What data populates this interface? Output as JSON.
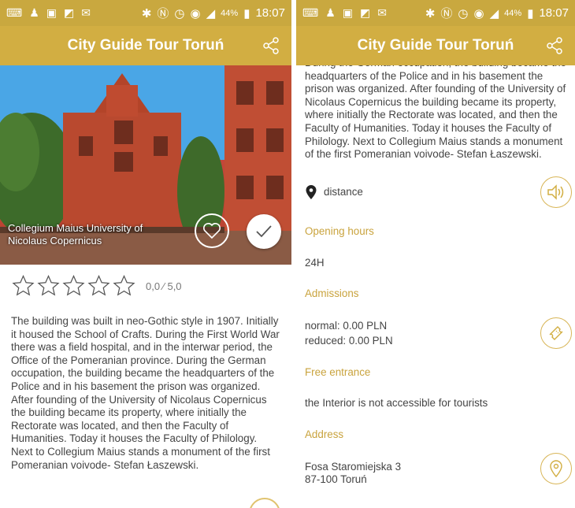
{
  "status": {
    "battery": "44%",
    "time": "18:07"
  },
  "app": {
    "title": "City Guide Tour Toruń"
  },
  "place": {
    "caption": "Collegium Maius University of Nicolaus Copernicus",
    "rating": "0,0 ⁄ 5,0",
    "description": "The building was built in neo-Gothic style in 1907. Initially it housed the School of Crafts. During the First World War there was a field hospital, and in the interwar period, the Office of the Pomeranian province. During the German occupation, the building became the headquarters of the Police and in his basement the prison was organized. After founding of the University of Nicolaus Copernicus the building became its property, where initially the Rectorate was located, and then the Faculty of Humanities. Today it houses the Faculty of Philology. Next to Collegium Maius stands a monument of the first Pomeranian voivode- Stefan Łaszewski."
  },
  "details": {
    "description_tail": "During the German occupation, the building became the headquarters of the Police and in his basement the prison was organized. After founding of the University of Nicolaus Copernicus the building became its property, where initially the Rectorate was located, and then the Faculty of Humanities. Today it houses the Faculty of Philology. Next to Collegium Maius stands a monument of the first Pomeranian voivode- Stefan Łaszewski.",
    "distance_label": "distance",
    "opening_hours_label": "Opening hours",
    "opening_hours_value": "24H",
    "admissions_label": "Admissions",
    "admission_normal": "normal: 0.00 PLN",
    "admission_reduced": "reduced: 0.00 PLN",
    "free_entrance_label": "Free entrance",
    "free_entrance_value": "the Interior is not accessible for tourists",
    "address_label": "Address",
    "address_line1": "Fosa Staromiejska 3",
    "address_line2": "87-100 Toruń"
  },
  "colors": {
    "accent": "#d2ae42",
    "label": "#c9a33d"
  },
  "icons": [
    "keyboard-icon",
    "person-icon",
    "image-icon",
    "photo-icon",
    "mail-icon",
    "bluetooth-icon",
    "nfc-icon",
    "alarm-icon",
    "wifi-icon",
    "signal-icon",
    "battery-icon",
    "share-icon",
    "heart-icon",
    "check-icon",
    "star-icon",
    "location-pin-icon",
    "speaker-icon",
    "ticket-icon",
    "map-pin-icon"
  ]
}
